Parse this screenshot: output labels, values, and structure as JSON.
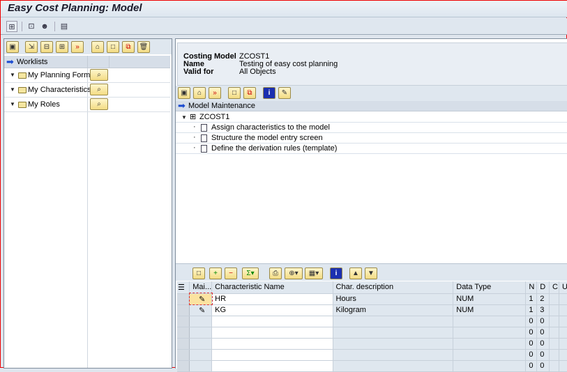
{
  "window": {
    "title": "Easy Cost Planning: Model"
  },
  "worklists": {
    "header": "Worklists",
    "items": [
      {
        "label": "My Planning Forms"
      },
      {
        "label": "My Characteristics"
      },
      {
        "label": "My Roles"
      }
    ]
  },
  "model_info": {
    "rows": [
      {
        "label": "Costing Model",
        "value": "ZCOST1"
      },
      {
        "label": "Name",
        "value": "Testing of easy cost planning"
      },
      {
        "label": "Valid for",
        "value": "All Objects"
      }
    ]
  },
  "maintenance": {
    "header": "Model Maintenance",
    "root": "ZCOST1",
    "items": [
      "Assign characteristics to the model",
      "Structure the model entry screen",
      "Define the derivation rules (template)"
    ]
  },
  "table": {
    "columns": [
      "Mai...",
      "Characteristic Name",
      "Char. description",
      "Data Type",
      "N",
      "D",
      "C",
      "U"
    ],
    "rows": [
      [
        "",
        "HR",
        "Hours",
        "NUM",
        "1",
        "2",
        "",
        ""
      ],
      [
        "",
        "KG",
        "Kilogram",
        "NUM",
        "1",
        "3",
        "",
        ""
      ],
      [
        "",
        "",
        "",
        "",
        "0",
        "0",
        "",
        ""
      ],
      [
        "",
        "",
        "",
        "",
        "0",
        "0",
        "",
        ""
      ],
      [
        "",
        "",
        "",
        "",
        "0",
        "0",
        "",
        ""
      ],
      [
        "",
        "",
        "",
        "",
        "0",
        "0",
        "",
        ""
      ],
      [
        "",
        "",
        "",
        "",
        "0",
        "0",
        "",
        ""
      ]
    ]
  },
  "colors": {
    "accent_button": "#f3dc84",
    "header_bg": "#d6dee8",
    "frame_border": "#e00000"
  }
}
